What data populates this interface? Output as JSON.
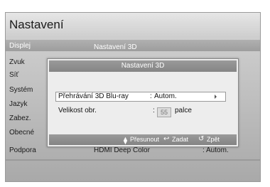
{
  "header": {
    "title": "Nastavení"
  },
  "sidebar": {
    "items": [
      {
        "label": "Displej"
      },
      {
        "label": "Zvuk"
      },
      {
        "label": "Síť"
      },
      {
        "label": "Systém"
      },
      {
        "label": "Jazyk"
      },
      {
        "label": "Zabez."
      },
      {
        "label": "Obecné"
      },
      {
        "label": "Podpora"
      }
    ]
  },
  "topbar": {
    "label": "Nastavení 3D"
  },
  "dialog": {
    "title": "Nastavení 3D",
    "rows": [
      {
        "label": "Přehrávání 3D Blu-ray",
        "separator": ":",
        "value": "Autom."
      },
      {
        "label": "Velikost obr.",
        "separator": ":",
        "value": "55",
        "unit": "palce"
      }
    ],
    "footer": {
      "move_label": "Přesunout",
      "enter_label": "Zadat",
      "back_label": "Zpět",
      "move_icon": "updown-icon",
      "enter_icon": "enter-icon",
      "back_icon": "return-icon"
    }
  },
  "bottom_row": {
    "label": "HDMI Deep Color",
    "value": ": Autom."
  }
}
